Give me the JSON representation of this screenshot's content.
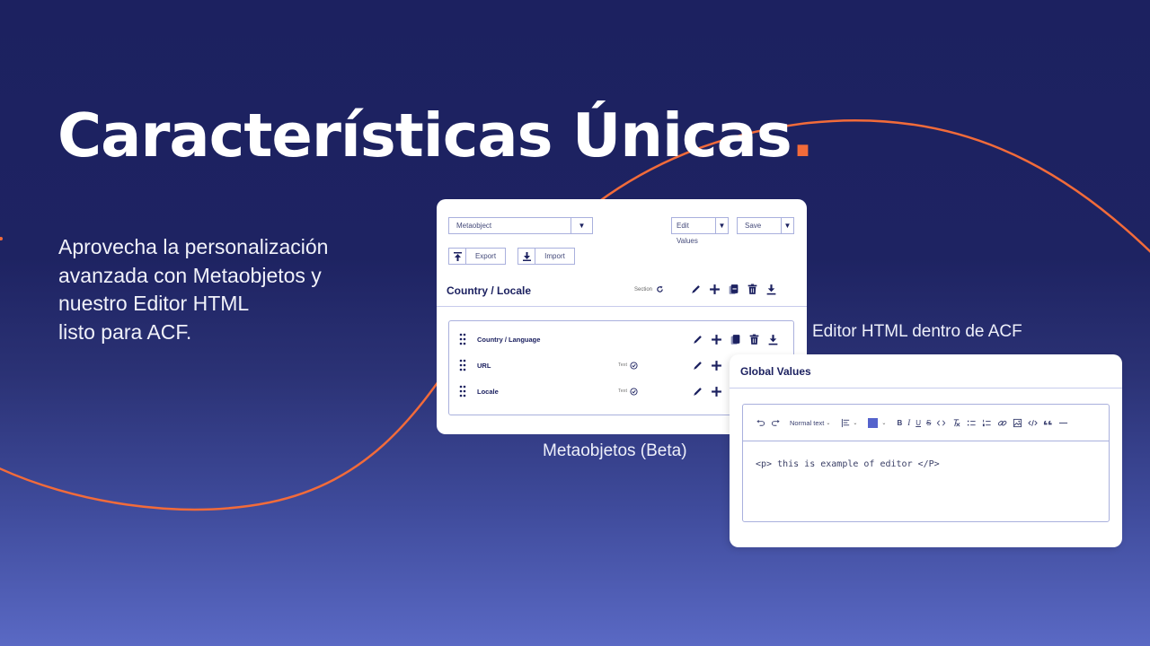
{
  "hero": {
    "title": "Características Únicas",
    "title_dot": ".",
    "subtitle": "Aprovecha la personalización\navanzada con Metaobjetos y\nnuestro Editor HTML\n listo para ACF."
  },
  "captions": {
    "metaobjects": "Metaobjetos (Beta)",
    "editor": "Editor HTML dentro de ACF"
  },
  "colors": {
    "accent": "#f26b3a",
    "navy": "#1c2160",
    "swatch": "#5563cc"
  },
  "metaobject_card": {
    "type_select": {
      "value": "Metaobject",
      "icon": "caret-down-icon"
    },
    "edit_values_select": {
      "value": "Edit Values",
      "icon": "caret-down-icon"
    },
    "save_select": {
      "value": "Save",
      "icon": "caret-down-icon"
    },
    "export_button": {
      "label": "Export",
      "icon": "upload-icon"
    },
    "import_button": {
      "label": "Import",
      "icon": "download-icon"
    },
    "section": {
      "title": "Country / Locale",
      "tag": "Section",
      "tag_icon": "refresh-icon",
      "actions": [
        "edit-icon",
        "add-icon",
        "copy-icon",
        "delete-icon",
        "download-icon"
      ]
    },
    "fields": [
      {
        "name": "Country / Language",
        "type": "",
        "actions": [
          "edit-icon",
          "add-icon",
          "copy-icon",
          "delete-icon",
          "download-icon"
        ]
      },
      {
        "name": "URL",
        "type": "Text",
        "type_icon": "check-circle-icon",
        "actions": [
          "edit-icon",
          "add-icon"
        ]
      },
      {
        "name": "Locale",
        "type": "Text",
        "type_icon": "check-circle-icon",
        "actions": [
          "edit-icon",
          "add-icon"
        ]
      }
    ]
  },
  "editor_card": {
    "title": "Global Values",
    "toolbar": {
      "undo": "undo-icon",
      "redo": "redo-icon",
      "block_format": "Normal text",
      "align": "align-icon",
      "color": "text-color-icon",
      "bold": "B",
      "italic": "I",
      "underline": "U",
      "strike": "S",
      "items": [
        "code-inline-icon",
        "clear-format-icon",
        "bullet-list-icon",
        "numbered-list-icon",
        "link-icon",
        "image-icon",
        "code-block-icon",
        "quote-icon",
        "horizontal-rule-icon"
      ]
    },
    "content": "<p> this is example of editor </P>"
  }
}
